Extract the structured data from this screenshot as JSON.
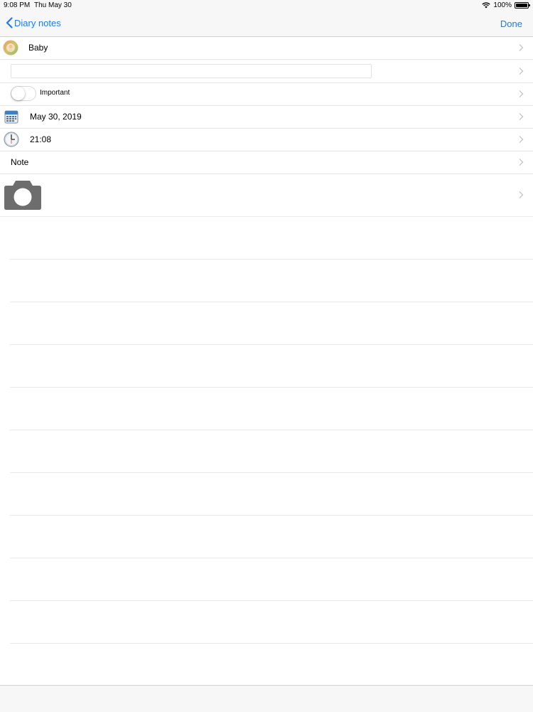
{
  "status_bar": {
    "time": "9:08 PM",
    "date": "Thu May 30",
    "battery": "100%"
  },
  "nav": {
    "back_label": "Diary notes",
    "done_label": "Done"
  },
  "rows": {
    "category": {
      "label": "Baby"
    },
    "title_field": {
      "value": "",
      "placeholder": ""
    },
    "important": {
      "label": "Important",
      "on": false
    },
    "date": {
      "label": "May 30, 2019"
    },
    "time": {
      "label": "21:08"
    },
    "note": {
      "label": "Note"
    }
  },
  "colors": {
    "accent": "#1a7cf2",
    "camera": "#6d6d6d"
  }
}
